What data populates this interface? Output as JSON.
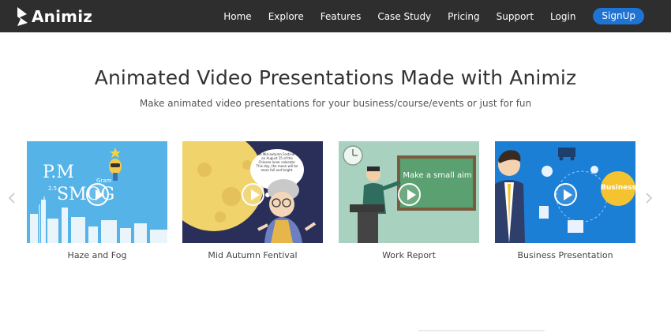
{
  "brand": {
    "name": "Animiz"
  },
  "nav": {
    "items": [
      "Home",
      "Explore",
      "Features",
      "Case Study",
      "Pricing",
      "Support",
      "Login"
    ],
    "signup_label": "SignUp"
  },
  "hero": {
    "title": "Animated Video Presentations Made with Animiz",
    "subtitle": "Make animated video presentations for your business/course/events or just for fun"
  },
  "cards": [
    {
      "caption": "Haze and Fog",
      "art": {
        "line1": "P.M",
        "sub1": "2.5",
        "sub2": "Gram",
        "line2": "SMOG"
      }
    },
    {
      "caption": "Mid Autumn Fentival",
      "art": {
        "bubble": "The Mid-autumn Festival is on August 15 of the Chinese lunar calendar. This day, the moon will be more full and bright."
      }
    },
    {
      "caption": "Work Report",
      "art": {
        "board": "Make a small aim"
      }
    },
    {
      "caption": "Business Presentation",
      "art": {
        "badge": "Business"
      }
    }
  ],
  "colors": {
    "navbar": "#2e2e2e",
    "signup": "#1e73d3",
    "card1_bg": "#55b3e8",
    "card2_bg": "#2a2f5a",
    "card3_bg": "#a9d1c0",
    "card4_bg": "#1b7fd6"
  }
}
